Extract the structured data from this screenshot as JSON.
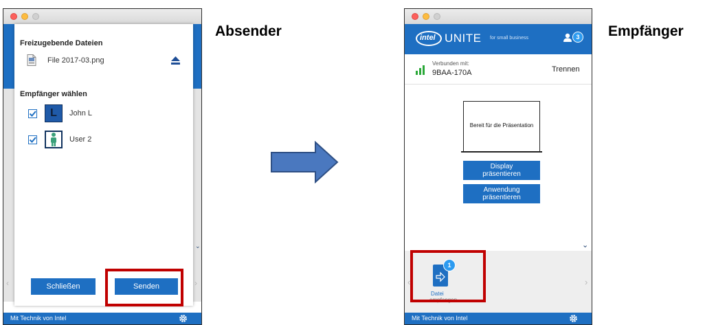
{
  "sender": {
    "shared_files_title": "Freizugebende Dateien",
    "file_name": "File 2017-03.png",
    "file_icon_caption": "PNG",
    "recipients_title": "Empfänger wählen",
    "recipients": [
      {
        "name": "John L",
        "avatar_letter": "L",
        "checked": true
      },
      {
        "name": "User 2",
        "checked": true
      }
    ],
    "close_button": "Schließen",
    "send_button": "Senden",
    "footer_text": "Mit Technik von Intel"
  },
  "label_sender": "Absender",
  "label_receiver": "Empfänger",
  "receiver": {
    "brand_intel": "intel",
    "brand_unite": "UNITE",
    "brand_tagline": "for small business",
    "participant_count": "3",
    "connected_label": "Verbunden mit:",
    "connected_id": "9BAA-170A",
    "disconnect_link": "Trennen",
    "ready_text": "Bereit für die Präsentation",
    "present_display_line1": "Display",
    "present_display_line2": "präsentieren",
    "present_app_line1": "Anwendung",
    "present_app_line2": "präsentieren",
    "file_badge": "1",
    "file_label": "Datei",
    "file_sublabel": "empfangen",
    "footer_text": "Mit Technik von Intel"
  },
  "colors": {
    "accent_blue": "#1e6fc2",
    "highlight_red": "#c00000",
    "arrow_blue": "#4a78bf"
  }
}
